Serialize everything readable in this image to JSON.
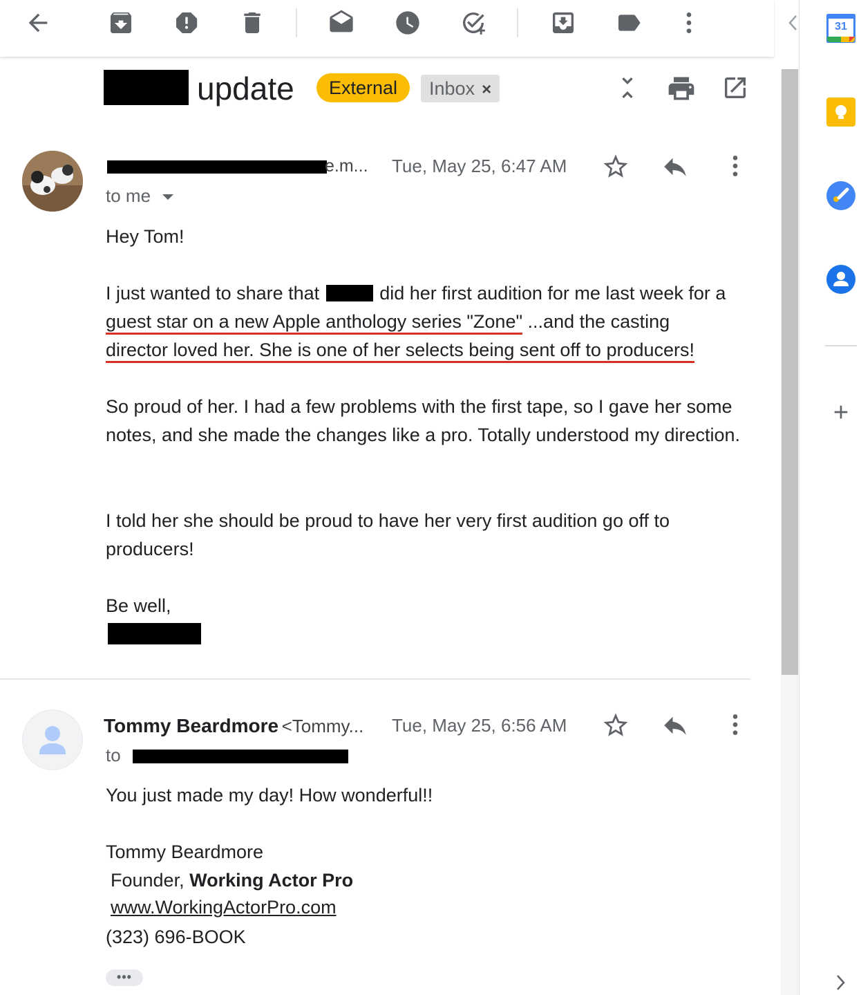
{
  "toolbar": {
    "icons": [
      "back-arrow-icon",
      "archive-icon",
      "report-spam-icon",
      "delete-icon",
      "mark-unread-icon",
      "snooze-icon",
      "add-task-icon",
      "move-to-icon",
      "label-icon",
      "more-vert-icon"
    ]
  },
  "thread": {
    "subject": "update",
    "labels": {
      "external": "External",
      "inbox": "Inbox",
      "remove": "×"
    },
    "actions": [
      "collapse-all-icon",
      "print-icon",
      "open-new-window-icon"
    ]
  },
  "message1": {
    "sender_visible_tail": "e.m...",
    "date": "Tue, May 25, 6:47 AM",
    "to": "to me",
    "greeting": "Hey Tom!",
    "p1_part1": "I just wanted to share that",
    "p1_part2": "did her first audition for me last week for a",
    "p1_line2": "guest star on a new Apple anthology series \"Zone\"",
    "p1_line2_rest": " ...and the casting",
    "p1_line3": "director loved her. She is one of her selects being sent off to producers!",
    "p2": "So proud of her. I had a few problems with the first tape, so I gave her some notes, and she made the changes like a pro. Totally understood my direction.",
    "p3": "I told her she should be proud to have her very first audition go off to producers!",
    "closing": "Be well,"
  },
  "message2": {
    "sender_name": "Tommy Beardmore",
    "sender_email": "<Tommy...",
    "date": "Tue, May 25, 6:56 AM",
    "to": "to",
    "body": "You just made my day! How wonderful!!",
    "sig_name": "Tommy Beardmore",
    "sig_title_prefix": "Founder, ",
    "sig_company": "Working Actor Pro",
    "sig_url": "www.WorkingActorPro.com",
    "sig_phone": "(323) 696-BOOK",
    "trimmed": "•••"
  },
  "sidebar": {
    "calendar_day": "31",
    "apps": [
      "calendar-icon",
      "keep-icon",
      "tasks-icon",
      "contacts-icon",
      "add-addon-icon"
    ]
  },
  "colors": {
    "external_chip": "#fbbc04",
    "inbox_chip": "#e0e0e0",
    "underline": "#d93025",
    "icon_gray": "#5f6368"
  }
}
